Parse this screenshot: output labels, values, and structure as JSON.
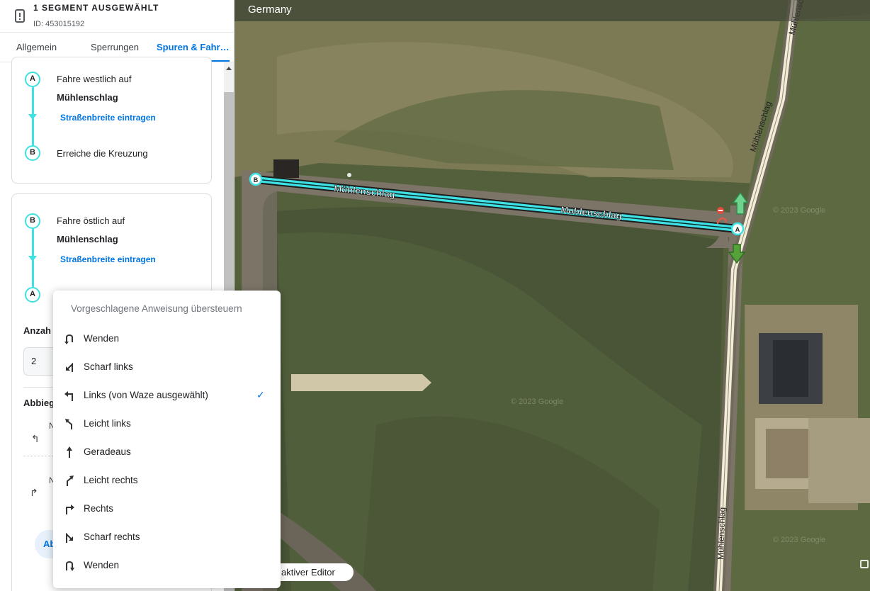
{
  "header": {
    "title": "1 SEGMENT AUSGEWÄHLT",
    "id_text": "ID: 453015192",
    "icon": "segment-warning-icon"
  },
  "tabs": [
    {
      "label": "Allgemein",
      "active": false
    },
    {
      "label": "Sperrungen",
      "active": false
    },
    {
      "label": "Spuren & Fahr…",
      "active": true
    }
  ],
  "directions": [
    {
      "from_node": "A",
      "to_node": "B",
      "drive_text": "Fahre westlich auf",
      "street": "Mühlenschlag",
      "width_link": "Straßenbreite eintragen",
      "arrive_text": "Erreiche die Kreuzung"
    },
    {
      "from_node": "B",
      "to_node": "A",
      "drive_text": "Fahre östlich auf",
      "street": "Mühlenschlag",
      "width_link": "Straßenbreite eintragen"
    }
  ],
  "lanes": {
    "count_label": "Anzah",
    "count_value": "2",
    "turns_label": "Abbieg",
    "row1_initial": "N",
    "row2_initial": "N",
    "button_label": "Ab"
  },
  "map": {
    "country": "Germany",
    "street_labels": [
      "Mühlenschlag",
      "Mühlenschlag",
      "Mühlenschlag",
      "Mühlenschlag",
      "Mühlenschlag"
    ],
    "node_a": "A",
    "node_b": "B",
    "watermarks": [
      "© 2023 Google",
      "© 2023 Google",
      "© 2023 Google"
    ],
    "editor_text": "aktiver Editor",
    "segment_color": "#3ee2e5",
    "arrow_color": "#4caf50"
  },
  "dropdown": {
    "header": "Vorgeschlagene Anweisung übersteuern",
    "items": [
      {
        "label": "Wenden",
        "icon": "u-turn-left-icon",
        "selected": false
      },
      {
        "label": "Scharf links",
        "icon": "sharp-left-icon",
        "selected": false
      },
      {
        "label": "Links (von Waze ausgewählt)",
        "icon": "turn-left-icon",
        "selected": true
      },
      {
        "label": "Leicht links",
        "icon": "slight-left-icon",
        "selected": false
      },
      {
        "label": "Geradeaus",
        "icon": "straight-icon",
        "selected": false
      },
      {
        "label": "Leicht rechts",
        "icon": "slight-right-icon",
        "selected": false
      },
      {
        "label": "Rechts",
        "icon": "turn-right-icon",
        "selected": false
      },
      {
        "label": "Scharf rechts",
        "icon": "sharp-right-icon",
        "selected": false
      },
      {
        "label": "Wenden",
        "icon": "u-turn-right-icon",
        "selected": false
      }
    ],
    "check_glyph": "✓"
  }
}
